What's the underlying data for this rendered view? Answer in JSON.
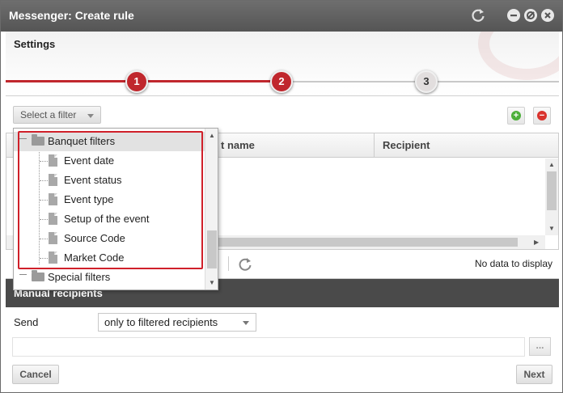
{
  "window": {
    "title": "Messenger: Create rule",
    "controls": [
      "refresh-icon",
      "minimize-icon",
      "restore-icon",
      "close-icon"
    ]
  },
  "settings": {
    "title": "Settings",
    "steps": [
      {
        "number": "1",
        "state": "done"
      },
      {
        "number": "2",
        "state": "current"
      },
      {
        "number": "3",
        "state": "pending"
      }
    ]
  },
  "toolbar": {
    "filter_label": "Select a filter",
    "add_icon": "add-icon",
    "remove_icon": "remove-icon"
  },
  "grid": {
    "columns": [
      "",
      "t name",
      "Recipient"
    ],
    "empty_text": "No data to display"
  },
  "filter_menu": {
    "groups": [
      {
        "label": "Banquet filters",
        "expanded": true,
        "items": [
          "Event date",
          "Event status",
          "Event type",
          "Setup of the event",
          "Source Code",
          "Market Code"
        ]
      },
      {
        "label": "Special filters",
        "expanded": false,
        "items": []
      }
    ]
  },
  "manual": {
    "title": "Manual recipients"
  },
  "send": {
    "label": "Send",
    "value": "only to filtered recipients",
    "more_label": "..."
  },
  "footer": {
    "cancel_label": "Cancel",
    "next_label": "Next"
  },
  "colors": {
    "accent": "#c0272d",
    "titlebar": "#5f5f5f",
    "section_bar": "#4a4a4a"
  }
}
